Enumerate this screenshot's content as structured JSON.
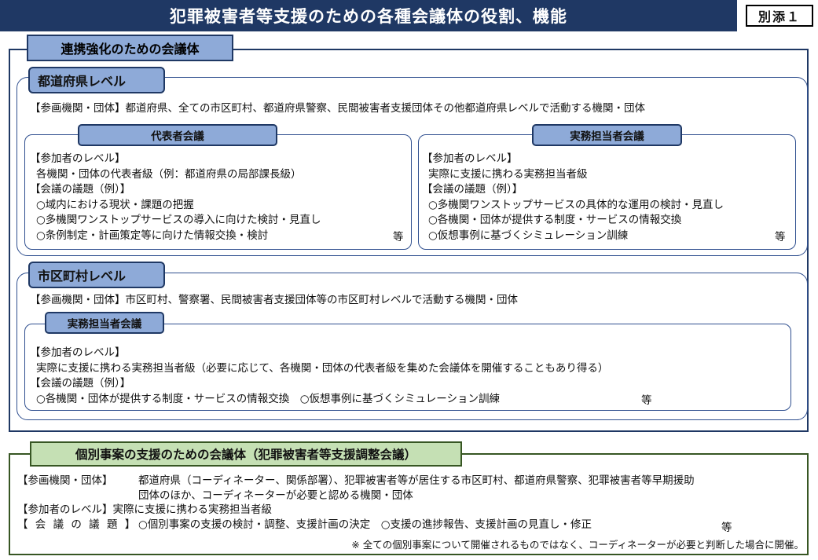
{
  "header": {
    "title": "犯罪被害者等支援のための各種会議体の役割、機能",
    "attachment": "別添１"
  },
  "coordination": {
    "heading": "連携強化のための会議体",
    "prefecture": {
      "heading": "都道府県レベル",
      "participants": "【参画機関・団体】都道府県、全ての市区町村、都道府県警察、民間被害者支援団体その他都道府県レベルで活動する機関・団体",
      "representative": {
        "heading": "代表者会議",
        "level_label": "【参加者のレベル】",
        "level_value": "各機関・団体の代表者級（例：都道府県の局部課長級）",
        "agenda_label": "【会議の議題（例）】",
        "agenda": [
          "○域内における現状・課題の把握",
          "○多機関ワンストップサービスの導入に向けた検討・見直し",
          "○条例制定・計画策定等に向けた情報交換・検討"
        ],
        "etc": "等"
      },
      "practitioner": {
        "heading": "実務担当者会議",
        "level_label": "【参加者のレベル】",
        "level_value": "実際に支援に携わる実務担当者級",
        "agenda_label": "【会議の議題（例）】",
        "agenda": [
          "○多機関ワンストップサービスの具体的な運用の検討・見直し",
          "○各機関・団体が提供する制度・サービスの情報交換",
          "○仮想事例に基づくシミュレーション訓練"
        ],
        "etc": "等"
      }
    },
    "municipal": {
      "heading": "市区町村レベル",
      "participants": "【参画機関・団体】市区町村、警察署、民間被害者支援団体等の市区町村レベルで活動する機関・団体",
      "practitioner": {
        "heading": "実務担当者会議",
        "level_label": "【参加者のレベル】",
        "level_value": "実際に支援に携わる実務担当者級（必要に応じて、各機関・団体の代表者級を集めた会議体を開催することもあり得る）",
        "agenda_label": "【会議の議題（例）】",
        "agenda": "○各機関・団体が提供する制度・サービスの情報交換　○仮想事例に基づくシミュレーション訓練",
        "etc": "等"
      }
    }
  },
  "individual": {
    "heading": "個別事案の支援のための会議体（犯罪被害者等支援調整会議）",
    "participants_label": "【参画機関・団体】",
    "participants_line1": "都道府県（コーディネーター、関係部署）、犯罪被害者等が居住する市区町村、都道府県警察、犯罪被害者等早期援助",
    "participants_line2": "団体のほか、コーディネーターが必要と認める機関・団体",
    "level_label": "【参加者のレベル】",
    "level_value": "実際に支援に携わる実務担当者級",
    "agenda_label": "【 会 議 の 議 題 】",
    "agenda_value": "○個別事案の支援の検討・調整、支援計画の決定　○支援の進捗報告、支援計画の見直し・修正",
    "etc": "等",
    "note": "※ 全ての個別事案について開催されるものではなく、コーディネーターが必要と判断した場合に開催。"
  }
}
